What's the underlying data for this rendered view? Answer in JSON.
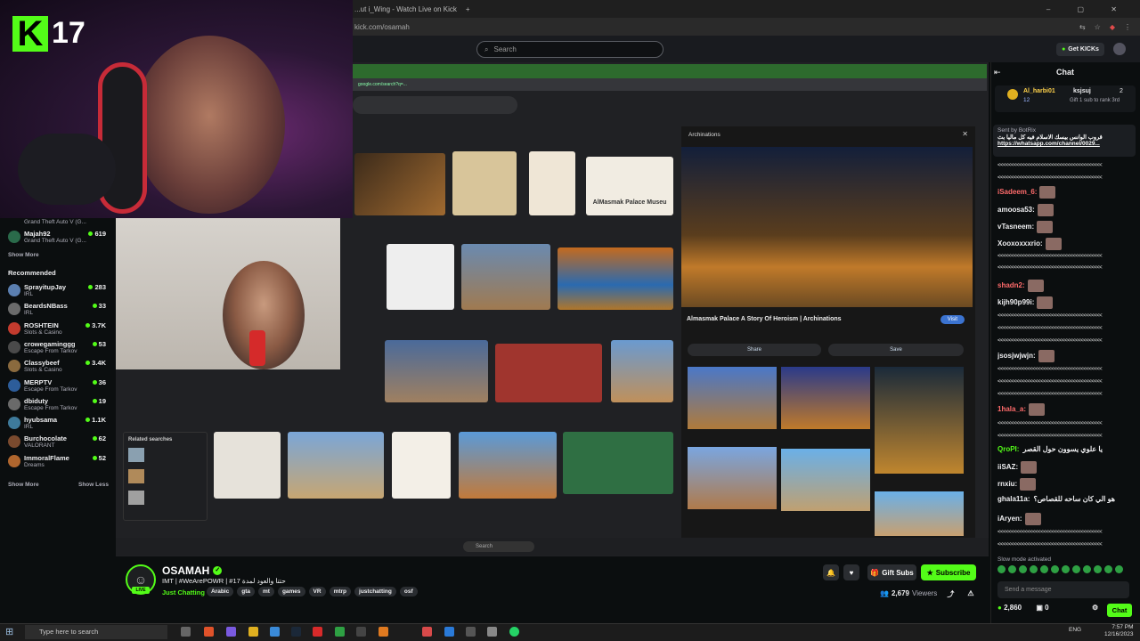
{
  "browser": {
    "tab_title": "...ut i_Wing - Watch Live on Kick",
    "url": "kick.com/osamah",
    "search_placeholder": "Search",
    "get_kicks": "Get KICKs"
  },
  "overlay": {
    "logo_letter": "K",
    "logo_number": "17"
  },
  "sidebar": {
    "following": [
      {
        "name": "Grand Theft Auto V (G...",
        "category": "",
        "count": ""
      },
      {
        "name": "Majah92",
        "category": "Grand Theft Auto V (G...",
        "count": "619"
      }
    ],
    "show_more_1": "Show More",
    "recommended_heading": "Recommended",
    "recommended": [
      {
        "name": "SprayitupJay",
        "category": "IRL",
        "count": "283",
        "color": "#5b7fb0"
      },
      {
        "name": "BeardsNBass",
        "category": "IRL",
        "count": "33",
        "color": "#6b6b6b"
      },
      {
        "name": "ROSHTEIN",
        "category": "Slots & Casino",
        "count": "3.7K",
        "color": "#c33b2e"
      },
      {
        "name": "crowegaminggg",
        "category": "Escape From Tarkov",
        "count": "53",
        "color": "#4a4a4a"
      },
      {
        "name": "Classybeef",
        "category": "Slots & Casino",
        "count": "3.4K",
        "color": "#8a6a3e"
      },
      {
        "name": "MERPTV",
        "category": "Escape From Tarkov",
        "count": "36",
        "color": "#2d5d9a"
      },
      {
        "name": "dbiduty",
        "category": "Escape From Tarkov",
        "count": "19",
        "color": "#6a6a6a"
      },
      {
        "name": "hyubsama",
        "category": "IRL",
        "count": "1.1K",
        "color": "#3e7a9b"
      },
      {
        "name": "Burchocolate",
        "category": "VALORANT",
        "count": "62",
        "color": "#7a4a2e"
      },
      {
        "name": "ImmoralFlame",
        "category": "Dreams",
        "count": "52",
        "color": "#b0662e"
      }
    ],
    "show_more_2": "Show More",
    "show_less": "Show Less"
  },
  "stream_screen": {
    "panel_title": "Archinations",
    "panel_caption": "Almasmak Palace A Story Of Heroism | Archinations",
    "visit": "Visit",
    "share": "Share",
    "save": "Save",
    "related_searches": "Related searches",
    "thumb_label": "AlMasmak Palace Museu",
    "url_line": "google.com/search?q=...",
    "search_label": "Search"
  },
  "channel": {
    "name": "OSAMAH",
    "live": "LIVE",
    "title": "IMT | #WeArePOWR | #17 حتتا والعود لمدة",
    "category": "Just Chatting",
    "tags": [
      "Arabic",
      "gta",
      "mt",
      "games",
      "VR",
      "mtrp",
      "justchatting",
      "osf"
    ],
    "gift_subs": "Gift Subs",
    "subscribe": "Subscribe",
    "viewers_count": "2,679",
    "viewers_label": "Viewers"
  },
  "chat": {
    "header": "Chat",
    "gift_user": "Al_harbi01",
    "gift_count": "12",
    "gift_user2": "ksjsuj",
    "gift_count2": "2",
    "gift_text": "Gift 1 sub to rank 3rd",
    "pinned_sender": "Sent by BotRix",
    "pinned_text": "قروب الوانس بيسك الاسلام فيه كل ماليا بث",
    "pinned_link": "https://whatsapp.com/channel/0029...",
    "messages": [
      {
        "user": "iSadeem_6:",
        "color": "#ff6b6b",
        "text": ""
      },
      {
        "user": "amoosa53:",
        "color": "#efeff1",
        "text": ""
      },
      {
        "user": "vTasneem:",
        "color": "#efeff1",
        "text": ""
      },
      {
        "user": "Xooxoxxxrio:",
        "color": "#efeff1",
        "text": ""
      },
      {
        "user": "shadn2:",
        "color": "#ff6b6b",
        "text": ""
      },
      {
        "user": "kijh90p99i:",
        "color": "#efeff1",
        "text": ""
      },
      {
        "user": "jsosjwjwjn:",
        "color": "#efeff1",
        "text": ""
      },
      {
        "user": "1hala_a:",
        "color": "#ff6b6b",
        "text": ""
      },
      {
        "user": "QroPI:",
        "color": "#53fc18",
        "text": "يا علوي يسوون حول القصر"
      },
      {
        "user": "iiSAZ:",
        "color": "#efeff1",
        "text": ""
      },
      {
        "user": "rnxiu:",
        "color": "#efeff1",
        "text": ""
      },
      {
        "user": "ghala11a:",
        "color": "#efeff1",
        "text": "هو الي كان ساحه للقصاص؟"
      },
      {
        "user": "iAryen:",
        "color": "#efeff1",
        "text": ""
      }
    ],
    "emote_line": "<<<<<<<<<<<<<<<<<<<<<<<<<<<<<<<<<<<<<<<",
    "slow_mode": "Slow mode activated",
    "input_placeholder": "Send a message",
    "kicks": "2,860",
    "zero": "0",
    "chat_button": "Chat"
  },
  "taskbar": {
    "search_placeholder": "Type here to search",
    "lang": "ENG",
    "time": "7:57 PM",
    "date": "12/16/2023"
  },
  "colors": {
    "kick_green": "#53fc18",
    "background": "#0b0e0f"
  }
}
